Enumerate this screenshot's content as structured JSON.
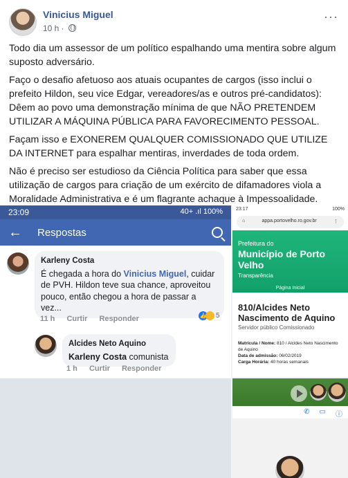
{
  "post": {
    "author": "Vinicius Miguel",
    "time": "10 h",
    "separator": "·",
    "more": "···",
    "paragraphs": [
      "Todo dia um assessor de um político espalhando uma mentira sobre algum suposto adversário.",
      "Faço o desafio afetuoso aos atuais ocupantes de cargos (isso inclui o prefeito Hildon, seu vice Edgar, vereadores/as e outros pré-candidatos): Dêem ao povo uma demonstração mínima de que NÃO PRETENDEM UTILIZAR A MÁQUINA PÚBLICA PARA FAVORECIMENTO PESSOAL.",
      "Façam isso e EXONEREM QUALQUER COMISSIONADO QUE UTILIZE DA INTERNET para espalhar mentiras, inverdades de toda ordem.",
      "Não é preciso ser estudioso da Ciência Política para saber que essa utilização de cargos para criação de um exército de difamadores viola a Moralidade Administrativa e é um flagrante achaque à Impessoalidade."
    ]
  },
  "left_screenshot": {
    "status_time": "23:09",
    "status_right": "40+ .ıl 100%",
    "appbar_title": "Respostas",
    "back": "←",
    "comment1": {
      "name": "Karleny Costa",
      "text_before": "É chegada a hora do ",
      "mention": "Vinicius Miguel",
      "text_after": ", cuidar de PVH. Hildon teve sua chance, aproveitou pouco, então chegou a hora de passar a vez...",
      "time": "11 h",
      "like": "Curtir",
      "reply": "Responder",
      "reaction_count": "5"
    },
    "comment2": {
      "name": "Alcides Neto Aquino",
      "mention": "Karleny Costa",
      "text": " comunista",
      "time": "1 h",
      "like": "Curtir",
      "reply": "Responder"
    }
  },
  "right_screenshot": {
    "status_time": "23:17",
    "status_right": "100%",
    "url": "appa.portovelho.ro.gov.br",
    "hero_pre": "Prefeitura do",
    "hero_title": "Município de Porto Velho",
    "hero_sub": "Transparência",
    "hero_link": "Página Inicial",
    "person_name": "810/Alcides Neto Nascimento de Aquino",
    "person_role": "Servidor público Comissionado",
    "details": [
      {
        "label": "Matrícula / Nome:",
        "value": " 810 / Alcides Neto Nascimento de Aquino"
      },
      {
        "label": "Data de admissão:",
        "value": " 06/02/2019"
      },
      {
        "label": "Carga Horária:",
        "value": " 40 horas semanais"
      }
    ]
  },
  "colors": {
    "link": "#385898",
    "fb_blue": "#4267b2",
    "green": "#1fb57b"
  }
}
